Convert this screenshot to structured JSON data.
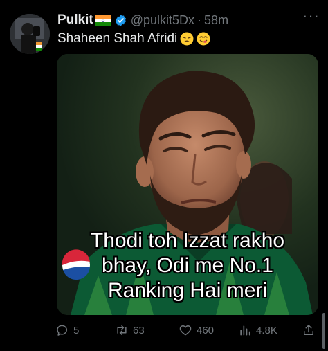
{
  "tweet": {
    "author_name": "Pulkit",
    "handle": "@pulkit5Dx",
    "separator": "·",
    "timestamp": "58m",
    "text": "Shaheen Shah Afridi",
    "more_label": "···"
  },
  "media": {
    "caption_line1": "Thodi toh Izzat rakho",
    "caption_line2": "bhay, Odi me No.1",
    "caption_line3": "Ranking Hai meri"
  },
  "actions": {
    "replies": "5",
    "retweets": "63",
    "likes": "460",
    "views": "4.8K"
  },
  "icons": {
    "flag": "india-flag-icon",
    "verified": "verified-badge-icon",
    "emoji1": "weary-face-emoji-icon",
    "emoji2": "yum-face-emoji-icon",
    "reply": "reply-icon",
    "retweet": "retweet-icon",
    "like": "heart-icon",
    "views": "views-chart-icon",
    "share": "share-icon"
  },
  "colors": {
    "background": "#000000",
    "text_primary": "#e7e9ea",
    "text_secondary": "#71767b",
    "verified": "#1d9bf0"
  }
}
